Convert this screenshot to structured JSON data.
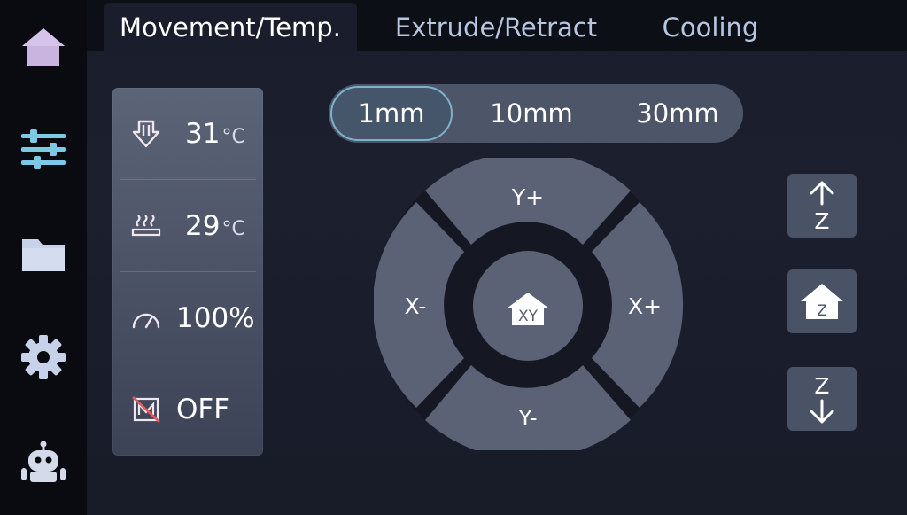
{
  "tabs": [
    {
      "label": "Movement/Temp."
    },
    {
      "label": "Extrude/Retract"
    },
    {
      "label": "Cooling"
    }
  ],
  "sidebar": {
    "items": [
      {
        "icon": "home-icon"
      },
      {
        "icon": "sliders-icon"
      },
      {
        "icon": "folder-icon"
      },
      {
        "icon": "gear-icon"
      },
      {
        "icon": "robot-icon"
      }
    ],
    "active_color": "#7cc9e6",
    "inactive_color": "#c9b9e0"
  },
  "status": {
    "nozzle": {
      "value": "31",
      "unit": "°C",
      "icon": "nozzle-temperature-icon"
    },
    "bed": {
      "value": "29",
      "unit": "°C",
      "icon": "bed-temperature-icon"
    },
    "speed": {
      "value": "100%",
      "icon": "speed-gauge-icon"
    },
    "motors": {
      "value": "OFF",
      "icon": "motor-off-icon"
    }
  },
  "steps": {
    "options": [
      "1mm",
      "10mm",
      "30mm"
    ],
    "selected": "1mm",
    "accent": "#7fb2c9"
  },
  "dpad": {
    "up": "Y+",
    "down": "Y-",
    "left": "X-",
    "right": "X+",
    "center": "XY"
  },
  "z_controls": {
    "up": "Z",
    "home": "Z",
    "down": "Z"
  }
}
